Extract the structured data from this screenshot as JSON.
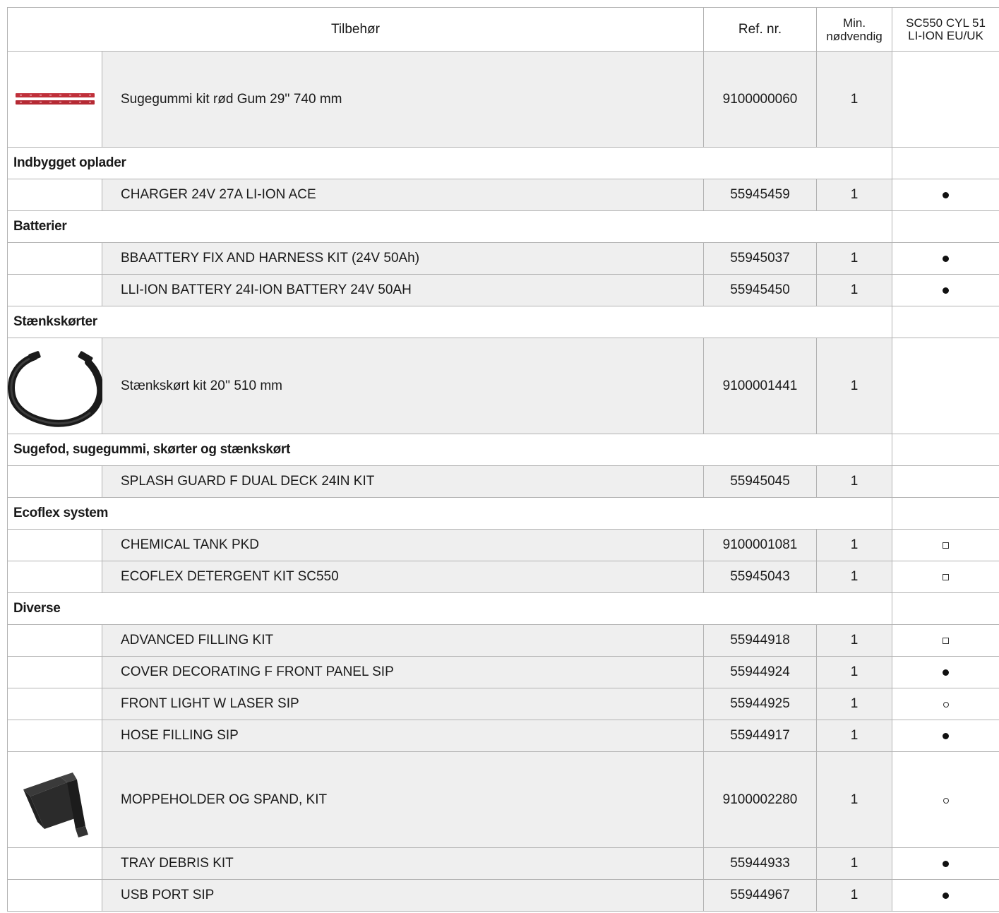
{
  "header": {
    "accessory": "Tilbehør",
    "ref": "Ref. nr.",
    "min_line1": "Min.",
    "min_line2": "nødvendig",
    "model_line1": "SC550 CYL 51",
    "model_line2": "LI-ION EU/UK"
  },
  "rows": [
    {
      "type": "item",
      "desc": "Sugegummi kit rød Gum 29'' 740 mm",
      "ref": "9100000060",
      "min": "1",
      "mark": "none",
      "image": "red-squeegee-image"
    },
    {
      "type": "category",
      "label": "Indbygget oplader"
    },
    {
      "type": "item",
      "desc": "CHARGER 24V 27A LI-ION ACE",
      "ref": "55945459",
      "min": "1",
      "mark": "standard"
    },
    {
      "type": "category",
      "label": "Batterier"
    },
    {
      "type": "item",
      "desc": "BBAATTERY FIX AND HARNESS KIT (24V 50Ah)",
      "ref": "55945037",
      "min": "1",
      "mark": "standard"
    },
    {
      "type": "item",
      "desc": "LLI-ION BATTERY 24I-ION BATTERY 24V 50AH",
      "ref": "55945450",
      "min": "1",
      "mark": "standard"
    },
    {
      "type": "category",
      "label": "Stænkskørter"
    },
    {
      "type": "item",
      "desc": "Stænkskørt kit 20'' 510 mm",
      "ref": "9100001441",
      "min": "1",
      "mark": "none",
      "image": "splash-skirt-image"
    },
    {
      "type": "category",
      "label": "Sugefod, sugegummi, skørter og stænkskørt"
    },
    {
      "type": "item",
      "desc": "SPLASH GUARD F DUAL DECK 24IN KIT",
      "ref": "55945045",
      "min": "1",
      "mark": "none"
    },
    {
      "type": "category",
      "label": "Ecoflex system"
    },
    {
      "type": "item",
      "desc": "CHEMICAL TANK PKD",
      "ref": "9100001081",
      "min": "1",
      "mark": "square"
    },
    {
      "type": "item",
      "desc": "ECOFLEX DETERGENT KIT SC550",
      "ref": "55945043",
      "min": "1",
      "mark": "square"
    },
    {
      "type": "category",
      "label": "Diverse"
    },
    {
      "type": "item",
      "desc": "ADVANCED FILLING KIT",
      "ref": "55944918",
      "min": "1",
      "mark": "square"
    },
    {
      "type": "item",
      "desc": "COVER DECORATING F FRONT PANEL SIP",
      "ref": "55944924",
      "min": "1",
      "mark": "standard"
    },
    {
      "type": "item",
      "desc": "FRONT LIGHT W LASER SIP",
      "ref": "55944925",
      "min": "1",
      "mark": "optional"
    },
    {
      "type": "item",
      "desc": "HOSE FILLING SIP",
      "ref": "55944917",
      "min": "1",
      "mark": "standard"
    },
    {
      "type": "item",
      "desc": "MOPPEHOLDER OG SPAND, KIT",
      "ref": "9100002280",
      "min": "1",
      "mark": "optional",
      "image": "mop-holder-image"
    },
    {
      "type": "item",
      "desc": "TRAY DEBRIS KIT",
      "ref": "55944933",
      "min": "1",
      "mark": "standard"
    },
    {
      "type": "item",
      "desc": "USB PORT SIP",
      "ref": "55944967",
      "min": "1",
      "mark": "standard"
    }
  ]
}
